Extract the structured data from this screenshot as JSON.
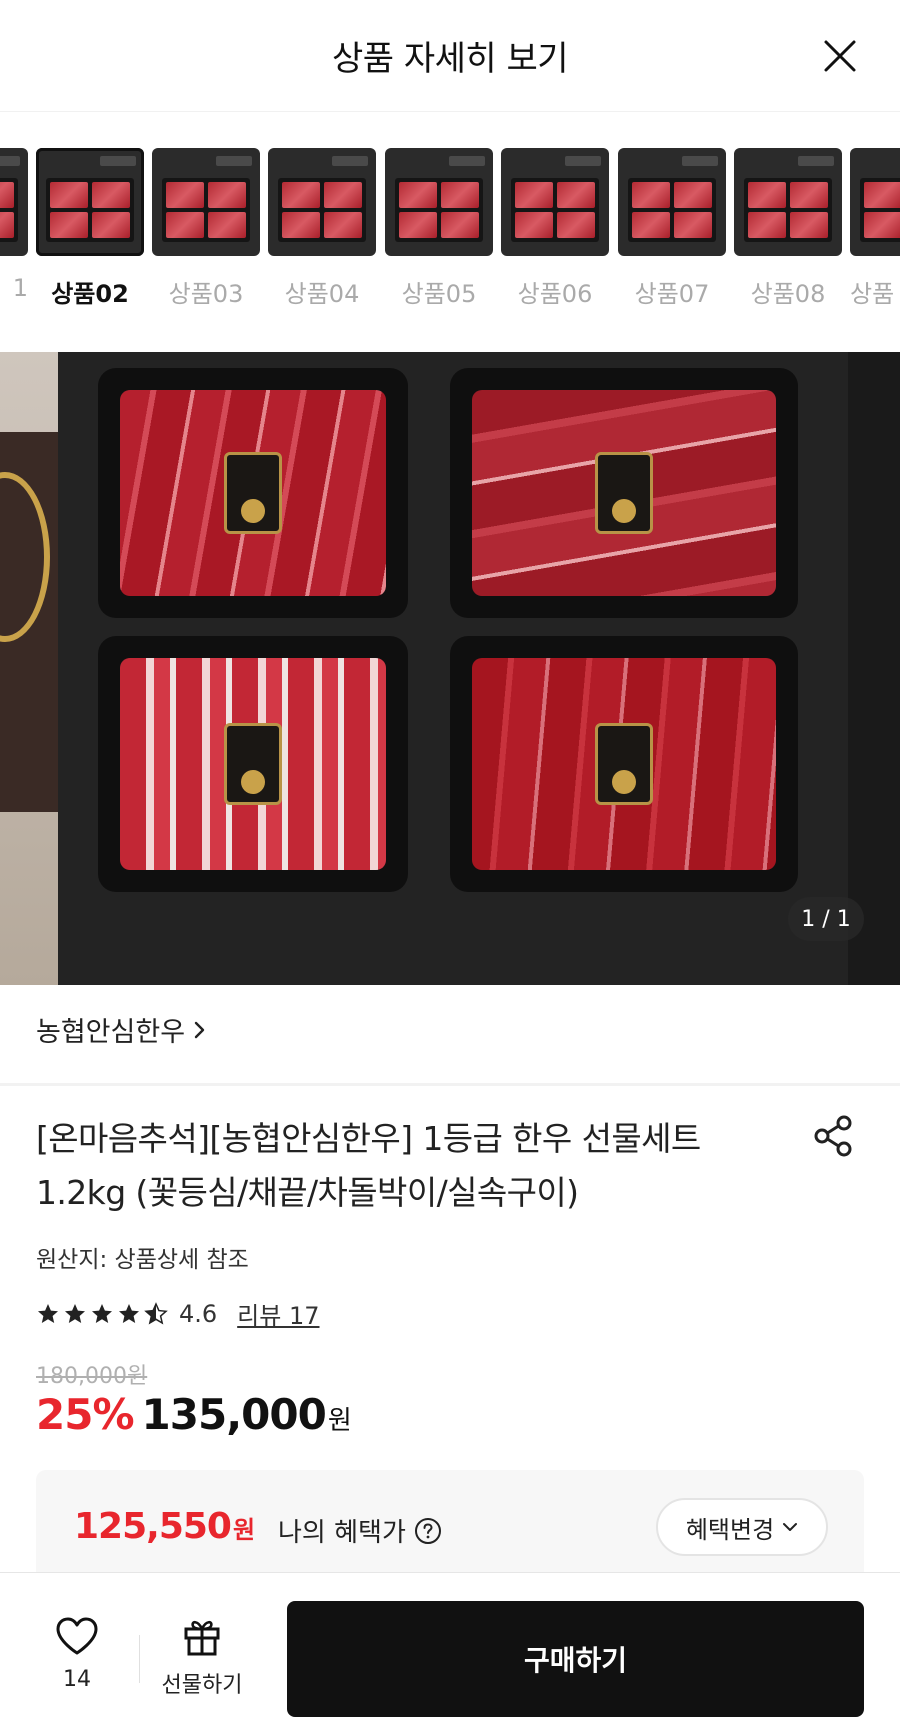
{
  "header": {
    "title": "상품 자세히 보기",
    "close_icon": "close-icon"
  },
  "thumbnails": {
    "items": [
      {
        "label": "1",
        "active": false
      },
      {
        "label": "상품02",
        "active": true
      },
      {
        "label": "상품03",
        "active": false
      },
      {
        "label": "상품04",
        "active": false
      },
      {
        "label": "상품05",
        "active": false
      },
      {
        "label": "상품06",
        "active": false
      },
      {
        "label": "상품07",
        "active": false
      },
      {
        "label": "상품08",
        "active": false
      },
      {
        "label": "상품",
        "active": false
      }
    ]
  },
  "gallery": {
    "counter": "1 / 1"
  },
  "brand": {
    "name": "농협안심한우",
    "chevron_icon": "chevron-right-icon"
  },
  "product": {
    "title_line1": "[온마음추석][농협안심한우] 1등급 한우 선물세트",
    "title_line2": "1.2kg (꽃등심/채끝/차돌박이/실속구이)",
    "origin": "원산지: 상품상세 참조",
    "rating": 4.6,
    "rating_text": "4.6",
    "review_link": "리뷰 17",
    "original_price": "180,000원",
    "discount": "25%",
    "sale_price": "135,000",
    "sale_unit": "원"
  },
  "benefit": {
    "amount": "125,550",
    "unit": "원",
    "label": "나의 혜택가",
    "change_button": "혜택변경"
  },
  "bottom_bar": {
    "like_count": "14",
    "gift_label": "선물하기",
    "buy_label": "구매하기"
  },
  "colors": {
    "accent_red": "#e8262d",
    "buy_button": "#111111"
  }
}
